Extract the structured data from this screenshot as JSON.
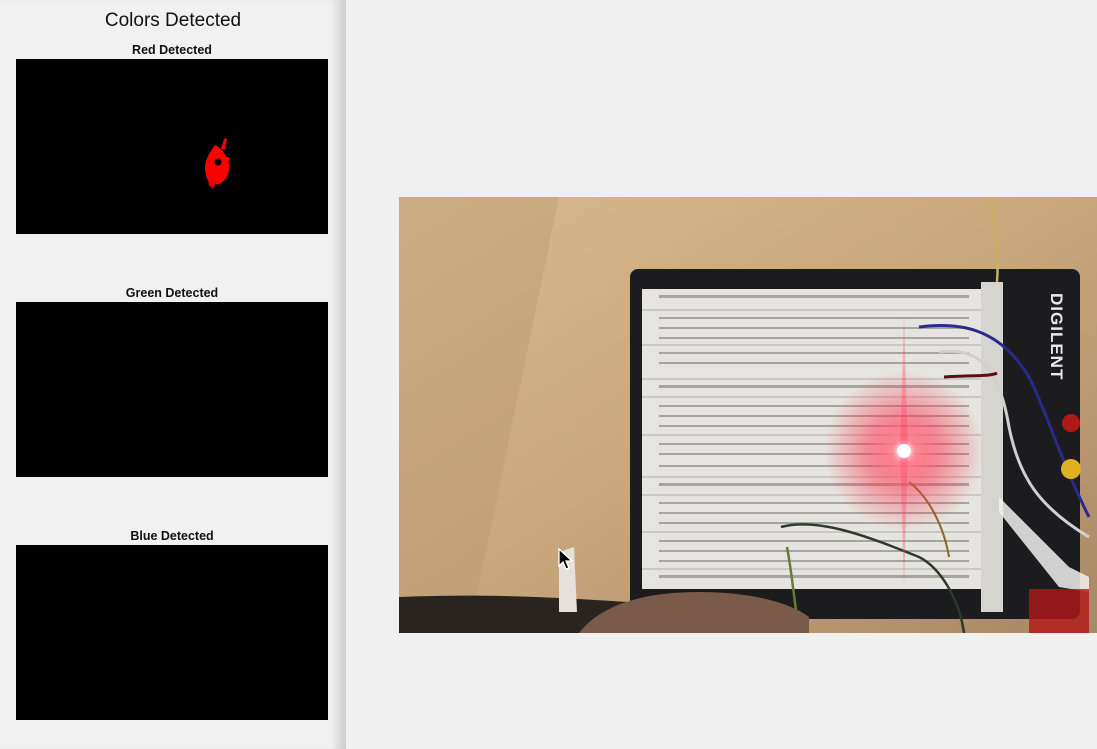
{
  "panel": {
    "title": "Colors Detected",
    "axes": [
      {
        "title": "Red Detected",
        "color": "#ff0000"
      },
      {
        "title": "Green Detected",
        "color": "#00ff00"
      },
      {
        "title": "Blue Detected",
        "color": "#0000ff"
      }
    ]
  },
  "video": {
    "board_brand": "DIGILENT",
    "led_color": "#ff3344"
  },
  "icons": {
    "cursor": "mouse-pointer-icon"
  }
}
